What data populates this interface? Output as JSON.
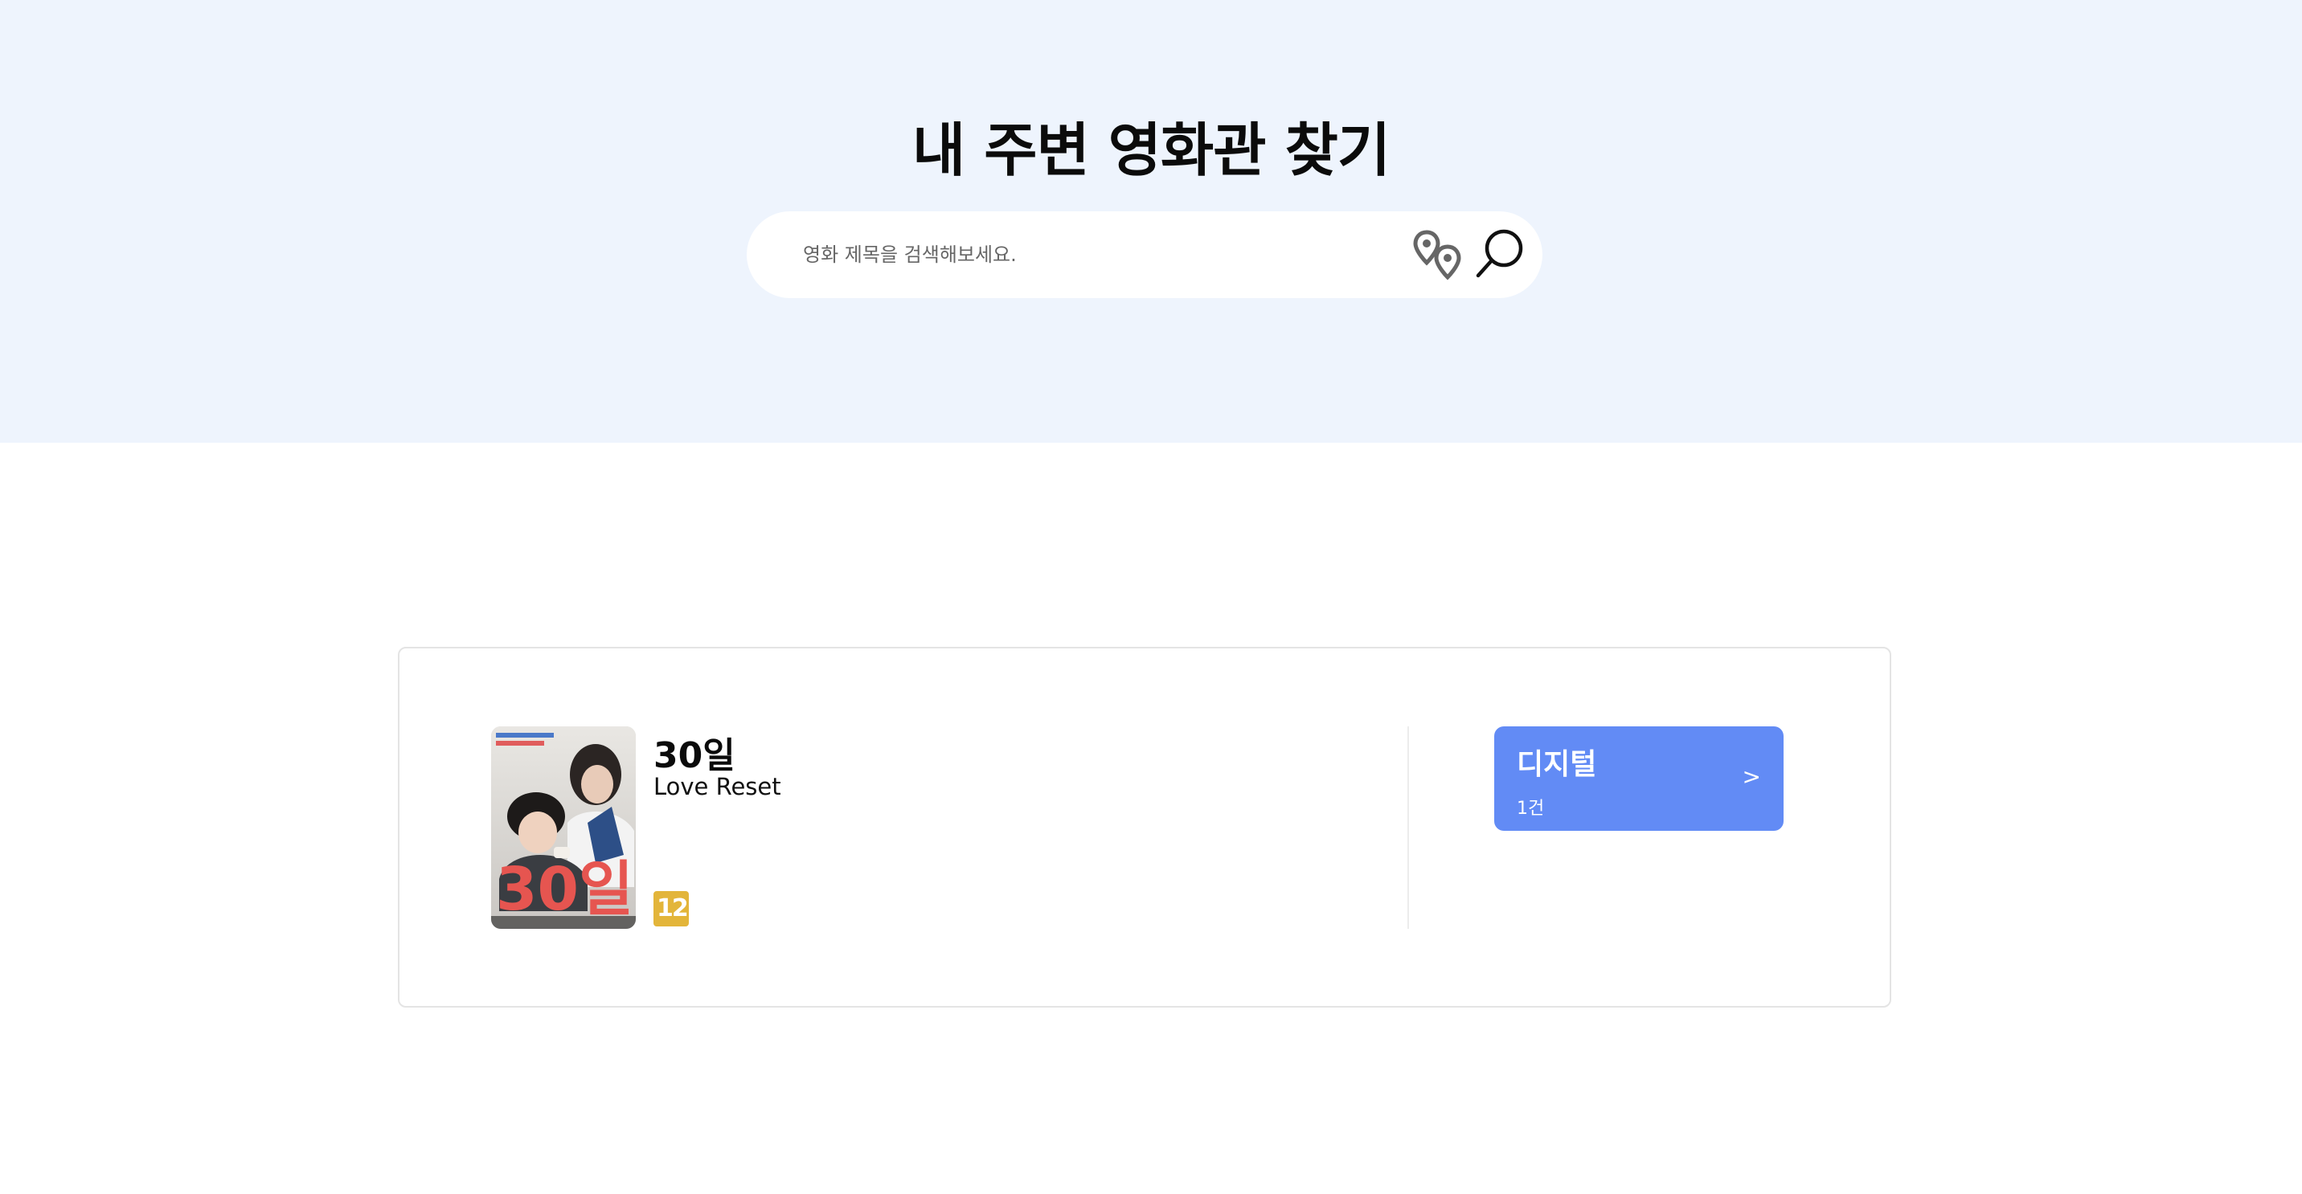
{
  "header": {
    "title": "내 주변 영화관 찾기"
  },
  "search": {
    "placeholder": "영화 제목을 검색해보세요.",
    "value": "",
    "location_icon": "location-pins-icon",
    "search_icon": "magnifier-icon"
  },
  "results": [
    {
      "title": "30일",
      "subtitle": "Love Reset",
      "rating": "12",
      "poster_title_text": "30일",
      "formats": [
        {
          "label": "디지털",
          "count": "1건",
          "arrow": ">"
        }
      ]
    }
  ],
  "colors": {
    "hero_background": "#eef4fd",
    "format_button": "#628bf5",
    "rating_badge": "#e3b53a"
  }
}
